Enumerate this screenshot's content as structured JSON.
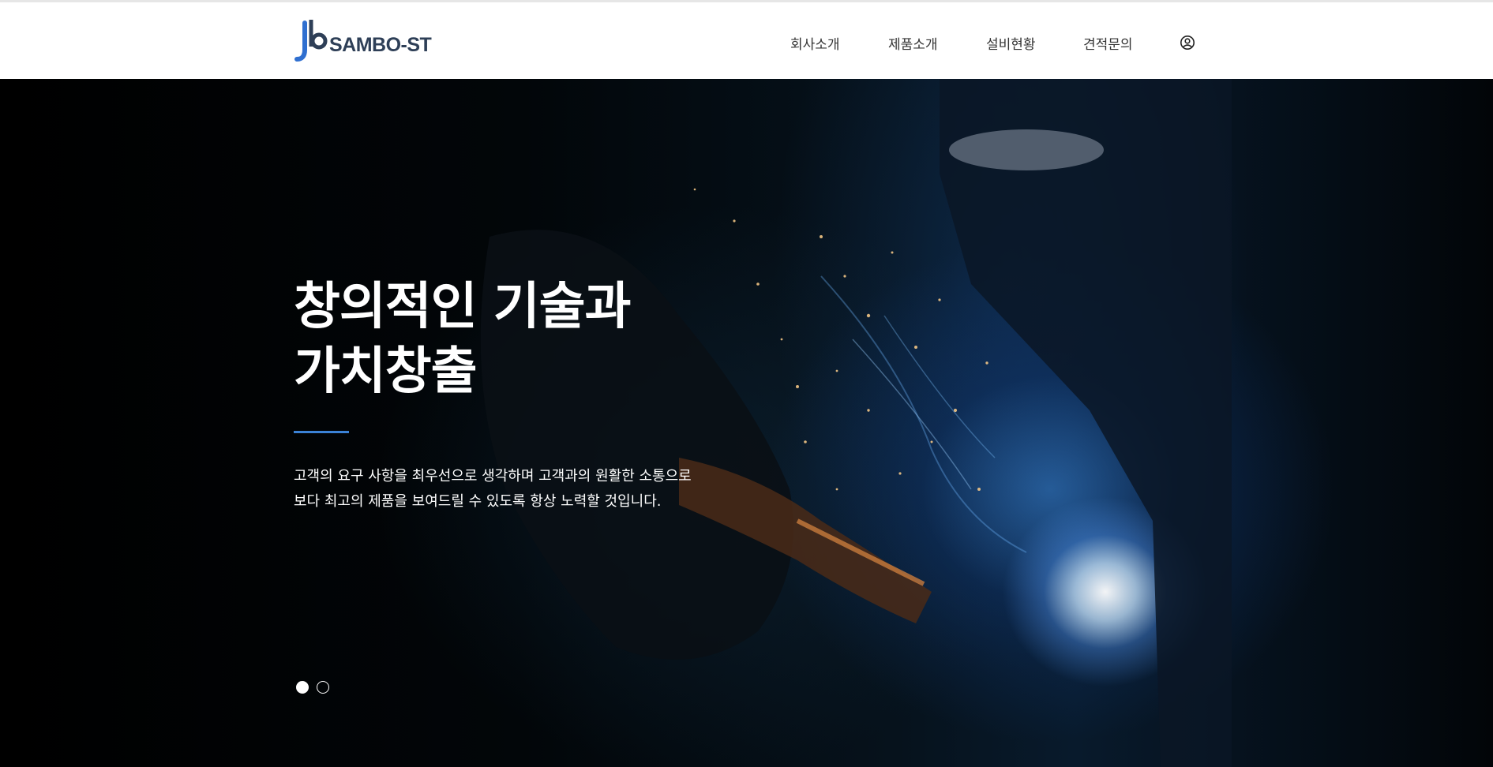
{
  "header": {
    "logo_text": "SAMBO-ST",
    "nav": [
      {
        "label": "회사소개"
      },
      {
        "label": "제품소개"
      },
      {
        "label": "설비현황"
      },
      {
        "label": "견적문의"
      }
    ],
    "user_icon": "user-circle-icon"
  },
  "hero": {
    "title": "창의적인 기술과\n가치창출",
    "description": "고객의 요구 사항을 최우선으로 생각하며 고객과의 원활한 소통으로\n보다 최고의 제품을 보여드릴 수 있도록 항상 노력할 것입니다.",
    "slides_total": 2,
    "active_slide": 1,
    "background": "welding-sparks-image"
  },
  "colors": {
    "accent": "#3b82d6",
    "logo_blue": "#2f6fd0",
    "logo_dark": "#2e3f57",
    "header_bg": "#ffffff"
  }
}
